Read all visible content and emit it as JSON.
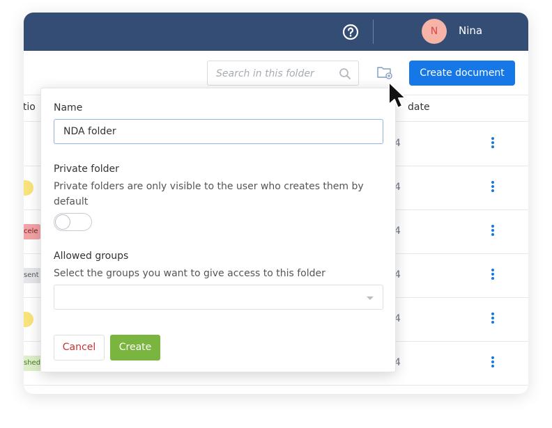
{
  "header": {
    "help_icon": "help-circle-icon",
    "user": {
      "initial": "N",
      "name": "Nina"
    }
  },
  "toolbar": {
    "search_placeholder": "Search in this folder",
    "search_icon": "search-icon",
    "new_folder_icon": "folder-plus-icon",
    "create_document_label": "Create document"
  },
  "table": {
    "col_left_header": "ptio",
    "col_date_header": "date",
    "rows": [
      {
        "date": "4",
        "badge": ""
      },
      {
        "date": "4",
        "badge": ""
      },
      {
        "date": "4",
        "badge": "cele"
      },
      {
        "date": "4",
        "badge": "sent"
      },
      {
        "date": "4",
        "badge": ""
      },
      {
        "date": "4",
        "badge": "shed"
      }
    ]
  },
  "modal": {
    "name_label": "Name",
    "name_value": "NDA folder",
    "private_label": "Private folder",
    "private_hint": "Private folders are only visible to the user who creates them by default",
    "private_enabled": false,
    "groups_label": "Allowed groups",
    "groups_hint": "Select the groups you want to give access to this folder",
    "groups_value": "",
    "cancel_label": "Cancel",
    "create_label": "Create"
  },
  "colors": {
    "topbar": "#344d74",
    "primary": "#1678e6",
    "create_green": "#7ab540",
    "cancel_red": "#c8322f"
  }
}
